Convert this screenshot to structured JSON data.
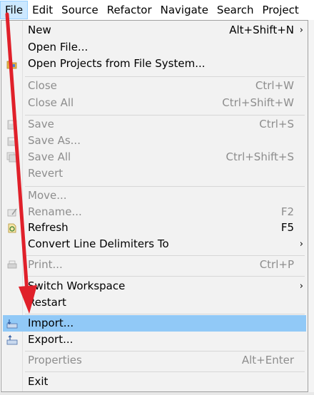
{
  "menubar": {
    "items": [
      "File",
      "Edit",
      "Source",
      "Refactor",
      "Navigate",
      "Search",
      "Project"
    ]
  },
  "file_menu": {
    "new": {
      "label": "New",
      "shortcut": "Alt+Shift+N"
    },
    "open_file": {
      "label": "Open File..."
    },
    "open_projects": {
      "label": "Open Projects from File System..."
    },
    "close": {
      "label": "Close",
      "shortcut": "Ctrl+W"
    },
    "close_all": {
      "label": "Close All",
      "shortcut": "Ctrl+Shift+W"
    },
    "save": {
      "label": "Save",
      "shortcut": "Ctrl+S"
    },
    "save_as": {
      "label": "Save As..."
    },
    "save_all": {
      "label": "Save All",
      "shortcut": "Ctrl+Shift+S"
    },
    "revert": {
      "label": "Revert"
    },
    "move": {
      "label": "Move..."
    },
    "rename": {
      "label": "Rename...",
      "shortcut": "F2"
    },
    "refresh": {
      "label": "Refresh",
      "shortcut": "F5"
    },
    "convert": {
      "label": "Convert Line Delimiters To"
    },
    "print": {
      "label": "Print...",
      "shortcut": "Ctrl+P"
    },
    "switch_workspace": {
      "label": "Switch Workspace"
    },
    "restart": {
      "label": "Restart"
    },
    "import": {
      "label": "Import..."
    },
    "export": {
      "label": "Export..."
    },
    "properties": {
      "label": "Properties",
      "shortcut": "Alt+Enter"
    },
    "exit": {
      "label": "Exit"
    }
  },
  "colors": {
    "highlight": "#91c9f7",
    "menubar_active": "#cce8ff",
    "annotation_arrow": "#e0202a",
    "disabled_text": "#8d8d8d"
  }
}
